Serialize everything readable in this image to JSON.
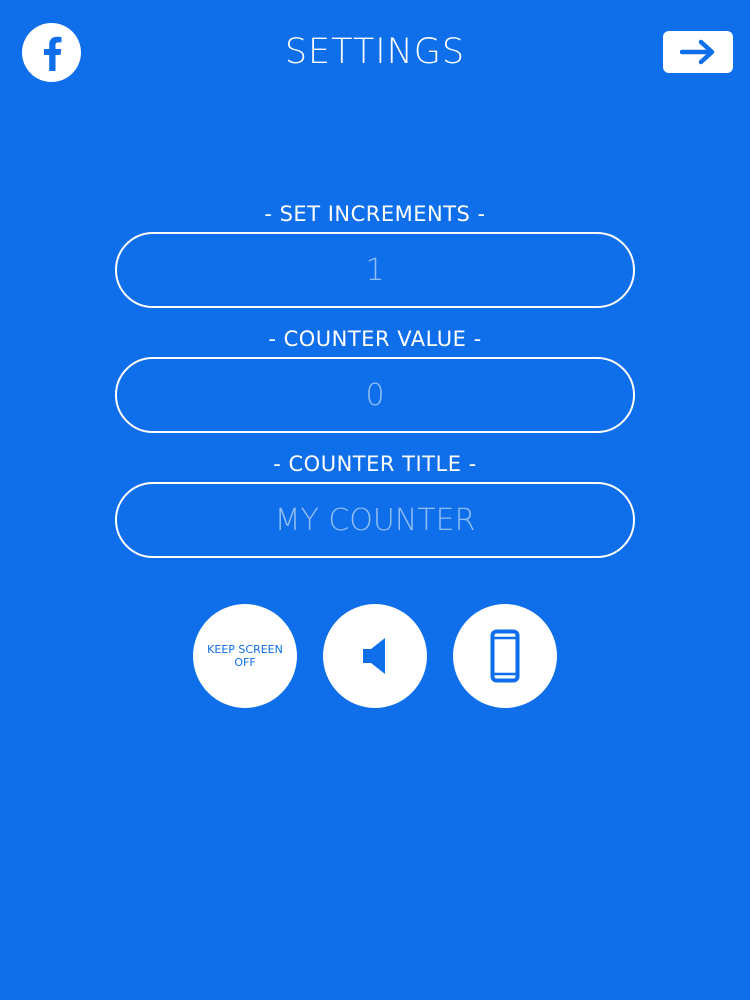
{
  "header": {
    "title": "SETTINGS",
    "facebook_icon": "facebook-icon",
    "next_icon": "arrow-right-icon"
  },
  "fields": {
    "increments": {
      "label": "- SET INCREMENTS -",
      "placeholder": "1"
    },
    "counter_value": {
      "label": "- COUNTER VALUE -",
      "placeholder": "0"
    },
    "counter_title": {
      "label": "- COUNTER TITLE -",
      "placeholder": "MY COUNTER"
    }
  },
  "buttons": {
    "keep_screen_label": "KEEP SCREEN OFF",
    "sound_icon": "speaker-icon",
    "vibrate_icon": "phone-icon"
  },
  "colors": {
    "background": "#0f6eea",
    "foreground": "#ffffff",
    "accent": "#0f6eea"
  }
}
